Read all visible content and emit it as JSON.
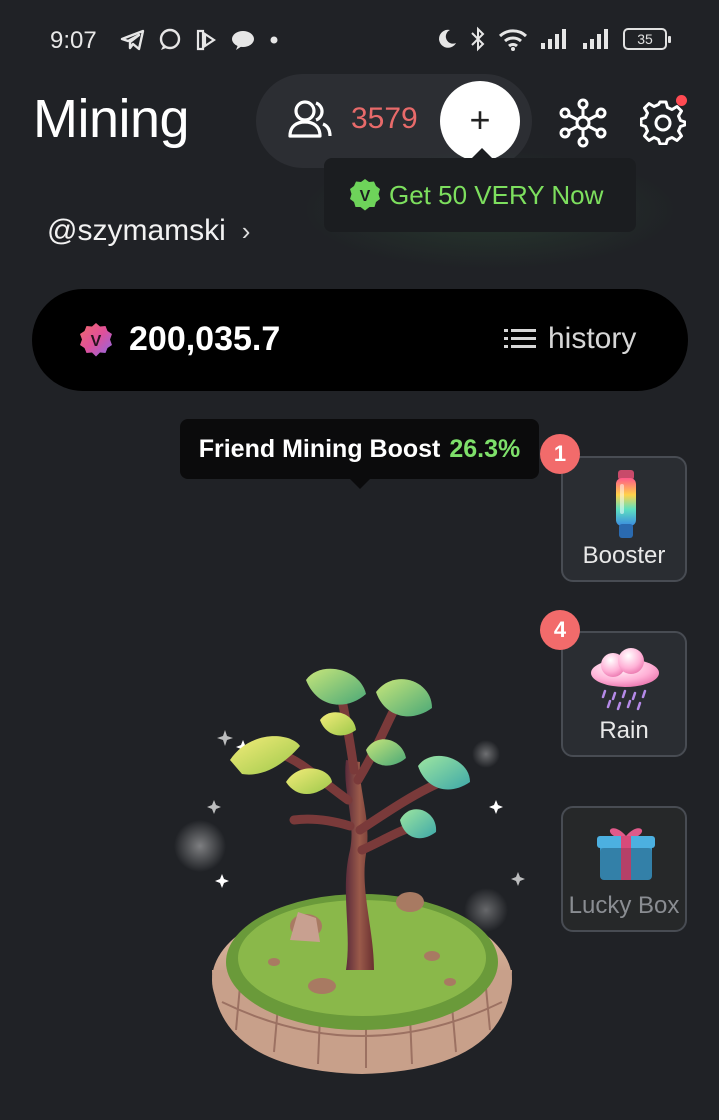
{
  "status_bar": {
    "time": "9:07",
    "battery": "35",
    "left_icons": [
      "telegram-icon",
      "chat-icon",
      "app-icon",
      "cloud-chat-icon",
      "dot-icon"
    ],
    "right_icons": [
      "moon-icon",
      "bluetooth-icon",
      "wifi-icon",
      "signal-icon",
      "signal-icon"
    ]
  },
  "header": {
    "title": "Mining",
    "friends_count": "3579",
    "add_label": "+",
    "settings_has_notification": true
  },
  "promo": {
    "badge_letter": "V",
    "text": "Get 50 VERY Now"
  },
  "user": {
    "handle": "@szymamski",
    "chevron": "›"
  },
  "balance": {
    "badge_letter": "V",
    "value": "200,035.7",
    "history_label": "history"
  },
  "boost": {
    "label": "Friend Mining Boost",
    "value": "26.3%"
  },
  "side_items": {
    "booster": {
      "label": "Booster",
      "badge": "1"
    },
    "rain": {
      "label": "Rain",
      "badge": "4"
    },
    "lucky_box": {
      "label": "Lucky Box"
    }
  },
  "colors": {
    "background": "#202226",
    "accent_green": "#7ddf5e",
    "count_red": "#e86a6a",
    "badge_red": "#f26b6b"
  }
}
